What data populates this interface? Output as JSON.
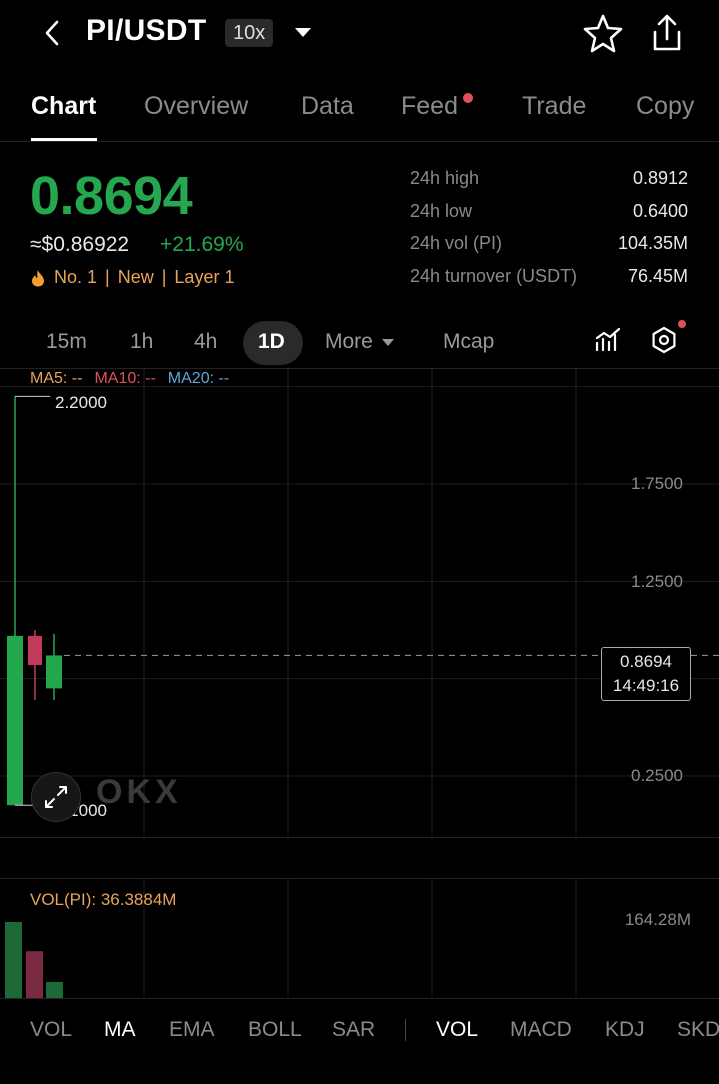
{
  "header": {
    "pair": "PI/USDT",
    "leverage": "10x",
    "icons": [
      "chevron-left-icon",
      "caret-down-icon",
      "star-icon",
      "share-icon"
    ]
  },
  "tabs": [
    {
      "label": "Chart",
      "active": true
    },
    {
      "label": "Overview",
      "active": false
    },
    {
      "label": "Data",
      "active": false
    },
    {
      "label": "Feed",
      "active": false,
      "badge": true
    },
    {
      "label": "Trade",
      "active": false
    },
    {
      "label": "Copy",
      "active": false
    }
  ],
  "ticker": {
    "last_price": "0.8694",
    "fiat_price": "≈$0.86922",
    "change_pct": "+21.69%",
    "rank": "No. 1",
    "tag_new": "New",
    "tag_layer": "Layer 1",
    "separator": "|"
  },
  "stats": [
    {
      "label": "24h high",
      "value": "0.8912"
    },
    {
      "label": "24h low",
      "value": "0.6400"
    },
    {
      "label": "24h vol (PI)",
      "value": "104.35M"
    },
    {
      "label": "24h turnover (USDT)",
      "value": "76.45M"
    }
  ],
  "intervals": [
    {
      "label": "15m",
      "active": false
    },
    {
      "label": "1h",
      "active": false
    },
    {
      "label": "4h",
      "active": false
    },
    {
      "label": "1D",
      "active": true
    },
    {
      "label": "More",
      "active": false
    },
    {
      "label": "Mcap",
      "active": false
    }
  ],
  "chart": {
    "ma_legend": {
      "ma5": "MA5: --",
      "ma10": "MA10: --",
      "ma20": "MA20: --"
    },
    "y_ticks": [
      "1.7500",
      "1.2500",
      "0.2500"
    ],
    "high_marker": "2.2000",
    "low_marker": "0.1000",
    "current_price": "0.8694",
    "countdown": "14:49:16",
    "watermark": "OKX",
    "colors": {
      "up": "#25a750",
      "down": "#c23a5a",
      "grid": "#1e1e1e"
    }
  },
  "chart_data": {
    "type": "candlestick",
    "candles": [
      {
        "open": 0.1,
        "high": 2.2,
        "low": 0.1,
        "close": 0.97,
        "direction": "up"
      },
      {
        "open": 0.97,
        "high": 1.0,
        "low": 0.64,
        "close": 0.82,
        "direction": "down"
      },
      {
        "open": 0.7,
        "high": 0.98,
        "low": 0.64,
        "close": 0.8694,
        "direction": "up"
      }
    ],
    "volumes": [
      {
        "value": 164.28,
        "direction": "up"
      },
      {
        "value": 102.0,
        "direction": "down"
      },
      {
        "value": 36.3884,
        "direction": "up"
      }
    ],
    "volume_unit": "M"
  },
  "volume_panel": {
    "label": "VOL(PI): 36.3884M",
    "max_label": "164.28M"
  },
  "indicators": {
    "main": [
      {
        "label": "VOL",
        "active": false
      },
      {
        "label": "MA",
        "active": true
      },
      {
        "label": "EMA",
        "active": false
      },
      {
        "label": "BOLL",
        "active": false
      },
      {
        "label": "SAR",
        "active": false
      }
    ],
    "sub": [
      {
        "label": "VOL",
        "active": true
      },
      {
        "label": "MACD",
        "active": false
      },
      {
        "label": "KDJ",
        "active": false
      },
      {
        "label": "SKD",
        "active": false
      }
    ]
  }
}
